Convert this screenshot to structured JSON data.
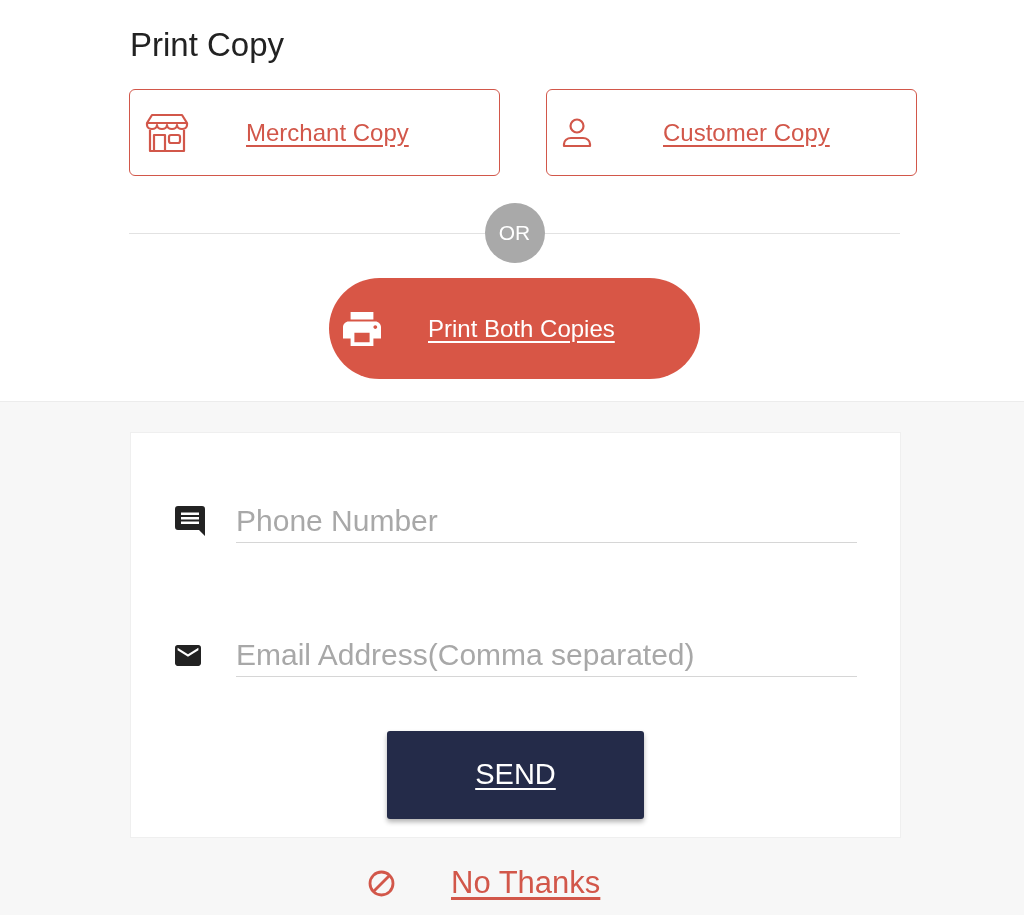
{
  "title": "Print Copy",
  "copy_options": [
    {
      "kind": "merchant",
      "label": "Merchant Copy"
    },
    {
      "kind": "customer",
      "label": "Customer Copy"
    }
  ],
  "divider": {
    "label": "OR"
  },
  "print_both_button": {
    "label": "Print Both Copies"
  },
  "send_form": {
    "fields": [
      {
        "kind": "phone",
        "placeholder": "Phone Number"
      },
      {
        "kind": "email",
        "placeholder": "Email Address(Comma separated)"
      }
    ],
    "send_button": {
      "label": "SEND"
    }
  },
  "no_thanks": {
    "label": "No Thanks"
  }
}
